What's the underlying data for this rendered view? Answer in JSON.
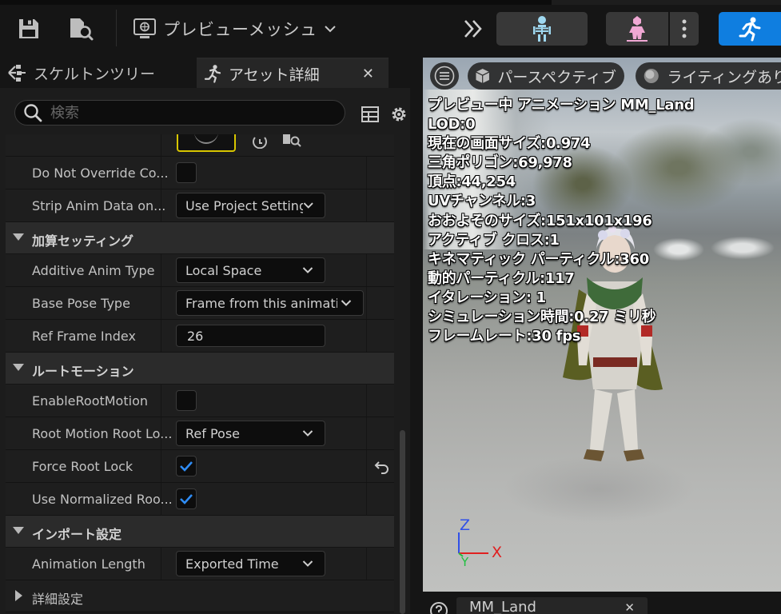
{
  "toolbar": {
    "preview_mesh_label": "プレビューメッシュ"
  },
  "tabs": {
    "skeleton_tree": "スケルトンツリー",
    "asset_details": "アセット詳細"
  },
  "search": {
    "placeholder": "検索"
  },
  "details": {
    "do_not_override": "Do Not Override Co...",
    "strip_anim_data": "Strip Anim Data on...",
    "strip_anim_value": "Use Project Setting",
    "additive_category": "加算セッティング",
    "additive_anim_type": "Additive Anim Type",
    "additive_anim_value": "Local Space",
    "base_pose_type": "Base Pose Type",
    "base_pose_value": "Frame from this animatio",
    "ref_frame_index": "Ref Frame Index",
    "ref_frame_value": "26",
    "root_motion_category": "ルートモーション",
    "enable_root_motion": "EnableRootMotion",
    "root_motion_root_lock": "Root Motion Root Lo...",
    "root_motion_root_lock_value": "Ref Pose",
    "force_root_lock": "Force Root Lock",
    "use_normalized_root": "Use Normalized Roo...",
    "import_category": "インポート設定",
    "animation_length": "Animation Length",
    "animation_length_value": "Exported Time",
    "advanced_category": "詳細設定"
  },
  "values": {
    "do_not_override_checked": false,
    "enable_root_motion_checked": false,
    "force_root_lock_checked": true,
    "use_normalized_root_checked": true
  },
  "viewport": {
    "perspective_label": "パースペクティブ",
    "lighting_label": "ライティングあり",
    "info": [
      "プレビュー中 アニメーション MM_Land",
      "LOD:0",
      "現在の画面サイズ:0.974",
      "三角ポリゴン:69,978",
      "頂点:44,254",
      "UVチャンネル:3",
      "おおよそのサイズ:151x101x196",
      "アクティブ クロス:1",
      "キネマティック パーティクル:360",
      "動的パーティクル:117",
      "イタレーション: 1",
      "シミュレーション時間:0.27 ミリ秒",
      "フレームレート:30 fps"
    ],
    "axis_z": "Z",
    "axis_x": "X",
    "axis_y": "Y"
  },
  "bottom_tab": {
    "label": "MM_Land"
  },
  "colors": {
    "accent": "#0f7ee0",
    "checkbox_check": "#2f8cf5",
    "axis_x": "#e02020",
    "axis_y": "#20c040",
    "axis_z": "#3050e8"
  }
}
